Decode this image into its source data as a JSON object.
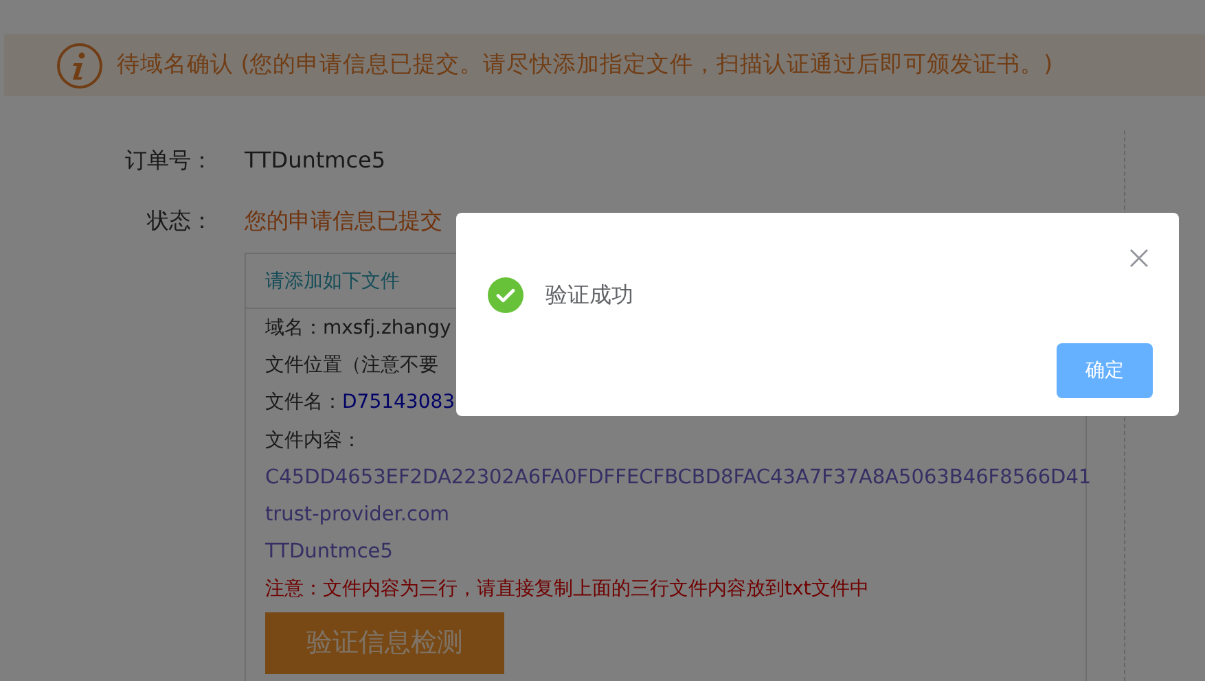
{
  "banner": {
    "text": "待域名确认 (您的申请信息已提交。请尽快添加指定文件，扫描认证通过后即可颁发证书。)"
  },
  "order": {
    "label": "订单号：",
    "value": "TTDuntmce5"
  },
  "status": {
    "label": "状态：",
    "value": "您的申请信息已提交"
  },
  "file_box": {
    "title": "请添加如下文件",
    "lines": [
      {
        "kind": "plain",
        "text": "域名：mxsfj.zhangy"
      },
      {
        "kind": "plain",
        "text": "文件位置（注意不要"
      },
      {
        "kind": "filename",
        "label": "文件名：",
        "value": "D75143083"
      },
      {
        "kind": "plain",
        "text": "文件内容："
      },
      {
        "kind": "content",
        "text": "C45DD4653EF2DA22302A6FA0FDFFECFBCBD8FAC43A7F37A8A5063B46F8566D41"
      },
      {
        "kind": "content",
        "text": "trust-provider.com"
      },
      {
        "kind": "content",
        "text": "TTDuntmce5"
      },
      {
        "kind": "note",
        "text": "注意：文件内容为三行，请直接复制上面的三行文件内容放到txt文件中"
      }
    ],
    "button": "验证信息检测"
  },
  "modal": {
    "message": "验证成功",
    "button": "确定"
  }
}
